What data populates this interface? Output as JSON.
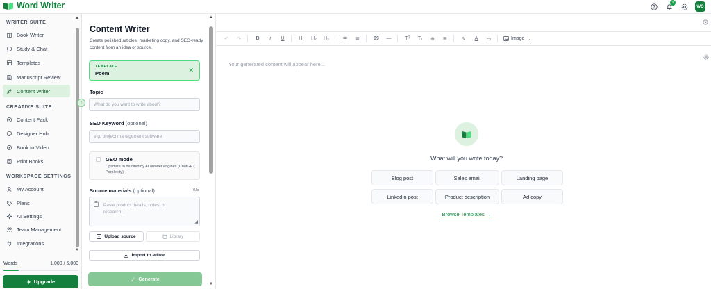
{
  "app": {
    "name": "Word Writer",
    "brand_color": "#15803d",
    "accent_light": "#dcf1df"
  },
  "topbar": {
    "notification_count": "1",
    "avatar_initials": "WO",
    "icons": [
      "help-icon",
      "bell-icon",
      "settings-icon"
    ]
  },
  "sidebar": {
    "sections": [
      {
        "title": "WRITER SUITE",
        "items": [
          {
            "label": "Book Writer",
            "icon": "book-icon"
          },
          {
            "label": "Study & Chat",
            "icon": "chat-icon"
          },
          {
            "label": "Templates",
            "icon": "template-icon"
          },
          {
            "label": "Manuscript Review",
            "icon": "document-icon"
          },
          {
            "label": "Content Writer",
            "icon": "pencil-icon",
            "active": true
          }
        ]
      },
      {
        "title": "CREATIVE SUITE",
        "items": [
          {
            "label": "Content Pack",
            "icon": "package-icon"
          },
          {
            "label": "Designer Hub",
            "icon": "palette-icon"
          },
          {
            "label": "Book to Video",
            "icon": "video-icon"
          },
          {
            "label": "Print Books",
            "icon": "printer-icon"
          }
        ]
      },
      {
        "title": "WORKSPACE SETTINGS",
        "items": [
          {
            "label": "My Account",
            "icon": "user-icon"
          },
          {
            "label": "Plans",
            "icon": "tag-icon"
          },
          {
            "label": "AI Settings",
            "icon": "sparkle-icon"
          },
          {
            "label": "Team Management",
            "icon": "team-icon"
          },
          {
            "label": "Integrations",
            "icon": "plug-icon"
          }
        ]
      }
    ],
    "words_label": "Words",
    "words_value": "1,000 / 5,000",
    "words_fraction": 0.2,
    "upgrade_label": "Upgrade"
  },
  "panel": {
    "title": "Content Writer",
    "description": "Create polished articles, marketing copy, and SEO-ready content from an idea or source.",
    "template_label": "TEMPLATE",
    "template_value": "Poem",
    "topic_label": "Topic",
    "topic_placeholder": "What do you want to write about?",
    "seo_label": "SEO Keyword",
    "seo_optional": "(optional)",
    "seo_placeholder": "e.g. project management software",
    "geo_title": "GEO mode",
    "geo_desc": "Optimize to be cited by AI answer engines (ChatGPT, Perplexity)",
    "source_label": "Source materials",
    "source_optional": "(optional)",
    "source_count": "0/5",
    "source_placeholder": "Paste product details, notes, or research...",
    "upload_label": "Upload source",
    "library_label": "Library",
    "import_label": "Import to editor",
    "generate_label": "Generate"
  },
  "editor": {
    "toolbar_image_label": "Image",
    "placeholder": "Your generated content will appear here...",
    "empty_title": "What will you write today?",
    "suggestions": [
      "Blog post",
      "Sales email",
      "Landing page",
      "LinkedIn post",
      "Product description",
      "Ad copy"
    ],
    "browse_label": "Browse Templates →"
  }
}
